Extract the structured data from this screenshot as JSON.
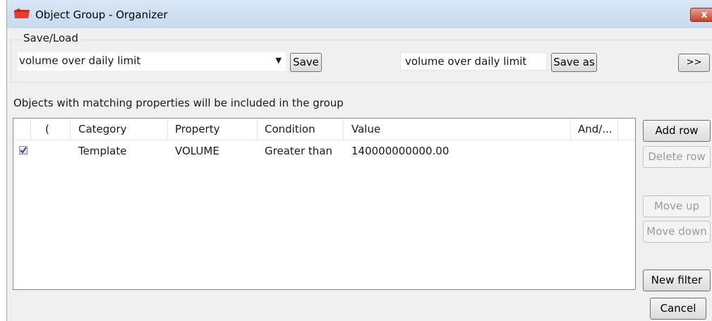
{
  "window": {
    "title": "Object Group - Organizer",
    "close_glyph": "x"
  },
  "saveload": {
    "label": "Save/Load",
    "selected_group": "volume over daily limit",
    "save_label": "Save",
    "save_as_name": "volume over daily limit",
    "save_as_label": "Save as",
    "expand_label": ">>"
  },
  "hint": "Objects with matching properties will be included in the group",
  "grid": {
    "columns": [
      "(",
      "Category",
      "Property",
      "Condition",
      "Value",
      "And/..."
    ],
    "rows": [
      {
        "checked": true,
        "paren": "",
        "category": "Template",
        "property": "VOLUME",
        "condition": "Greater than",
        "value": "140000000000.00",
        "andor": ""
      }
    ]
  },
  "side_buttons": {
    "add_row": "Add row",
    "delete_row": "Delete row",
    "move_up": "Move up",
    "move_down": "Move down",
    "new_filter": "New filter",
    "cancel": "Cancel"
  },
  "icons": {
    "app": "folder-icon",
    "close": "close-icon",
    "dropdown": "chevron-down-icon",
    "check": "check-icon"
  }
}
